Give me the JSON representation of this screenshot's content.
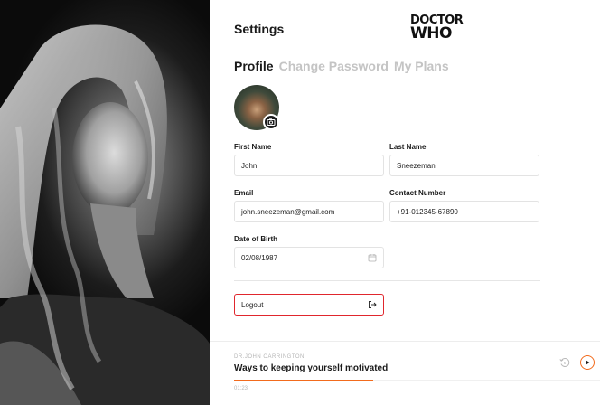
{
  "header": {
    "title": "Settings",
    "brand_line1": "DOCTOR",
    "brand_line2": "WHO"
  },
  "tabs": [
    {
      "label": "Profile",
      "active": true
    },
    {
      "label": "Change Password",
      "active": false
    },
    {
      "label": "My Plans",
      "active": false
    }
  ],
  "form": {
    "first_name": {
      "label": "First Name",
      "value": "John"
    },
    "last_name": {
      "label": "Last Name",
      "value": "Sneezeman"
    },
    "email": {
      "label": "Email",
      "value": "john.sneezeman@gmail.com"
    },
    "contact": {
      "label": "Contact Number",
      "value": "+91-012345-67890"
    },
    "dob": {
      "label": "Date of Birth",
      "value": "02/08/1987"
    }
  },
  "logout": {
    "label": "Logout"
  },
  "player": {
    "author": "DR.JOHN OARRINGTON",
    "title": "Ways to keeping yourself motivated",
    "time": "01:23",
    "progress": 0.38
  },
  "colors": {
    "accent": "#f26b1d",
    "logout_border": "#e0262d",
    "muted_tab": "#c4c4c4"
  },
  "icons": [
    "camera-icon",
    "calendar-icon",
    "logout-icon",
    "replay-icon",
    "play-icon"
  ]
}
